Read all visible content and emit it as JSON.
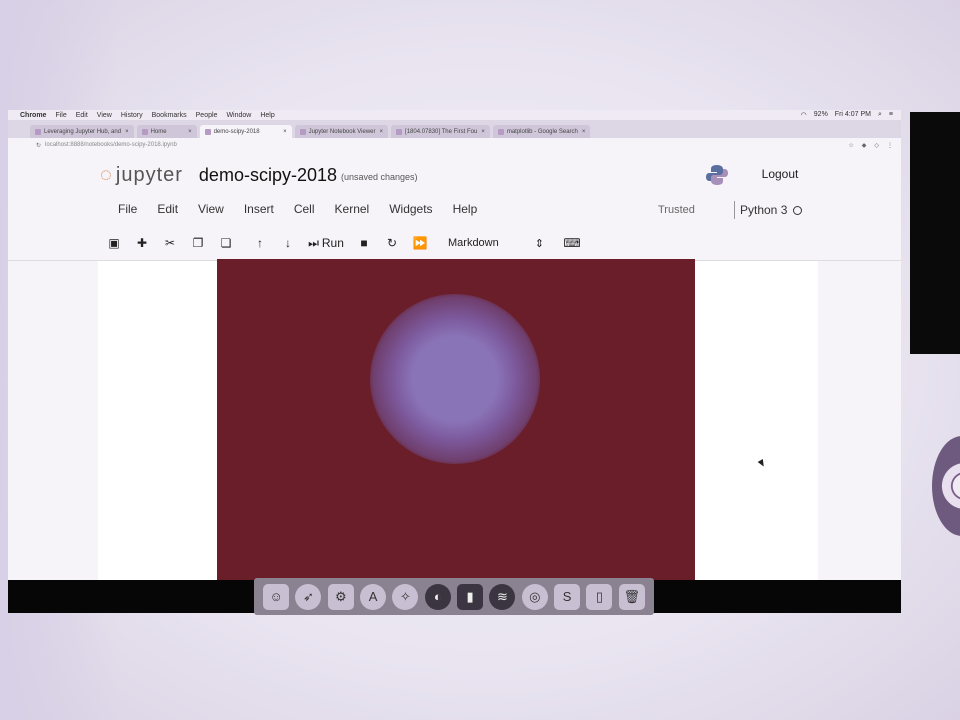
{
  "mac_menubar": {
    "items": [
      "Chrome",
      "File",
      "Edit",
      "View",
      "History",
      "Bookmarks",
      "People",
      "Window",
      "Help"
    ],
    "battery": "92%",
    "clock": "Fri 4:07 PM"
  },
  "browser_tabs": [
    {
      "label": "Leveraging Jupyter Hub, and",
      "active": false
    },
    {
      "label": "Home",
      "active": false
    },
    {
      "label": "demo-scipy-2018",
      "active": true
    },
    {
      "label": "Jupyter Notebook Viewer",
      "active": false
    },
    {
      "label": "[1804.07830] The First Fou",
      "active": false
    },
    {
      "label": "matplotlib - Google Search",
      "active": false
    }
  ],
  "address_bar": {
    "url": "localhost:8888/notebooks/demo-scipy-2018.ipynb"
  },
  "notebook": {
    "logo_text": "jupyter",
    "name": "demo-scipy-2018",
    "save_status": "(unsaved changes)",
    "logout_label": "Logout",
    "menu": [
      "File",
      "Edit",
      "View",
      "Insert",
      "Cell",
      "Kernel",
      "Widgets",
      "Help"
    ],
    "trusted_label": "Trusted",
    "kernel_name": "Python 3",
    "toolbar": {
      "run_label": "Run",
      "cell_type": "Markdown"
    }
  },
  "colors": {
    "output_background": "#6a1e2a",
    "blob_center": "#8a74b8",
    "jupyter_orange": "#d47a3c"
  },
  "dock": {
    "icons": [
      "finder-icon",
      "launchpad-icon",
      "system-preferences-icon",
      "app-store-icon",
      "safari-icon",
      "photos-icon",
      "terminal-icon",
      "spotify-icon",
      "chrome-icon",
      "sublime-text-icon",
      "document-icon",
      "trash-icon"
    ]
  }
}
